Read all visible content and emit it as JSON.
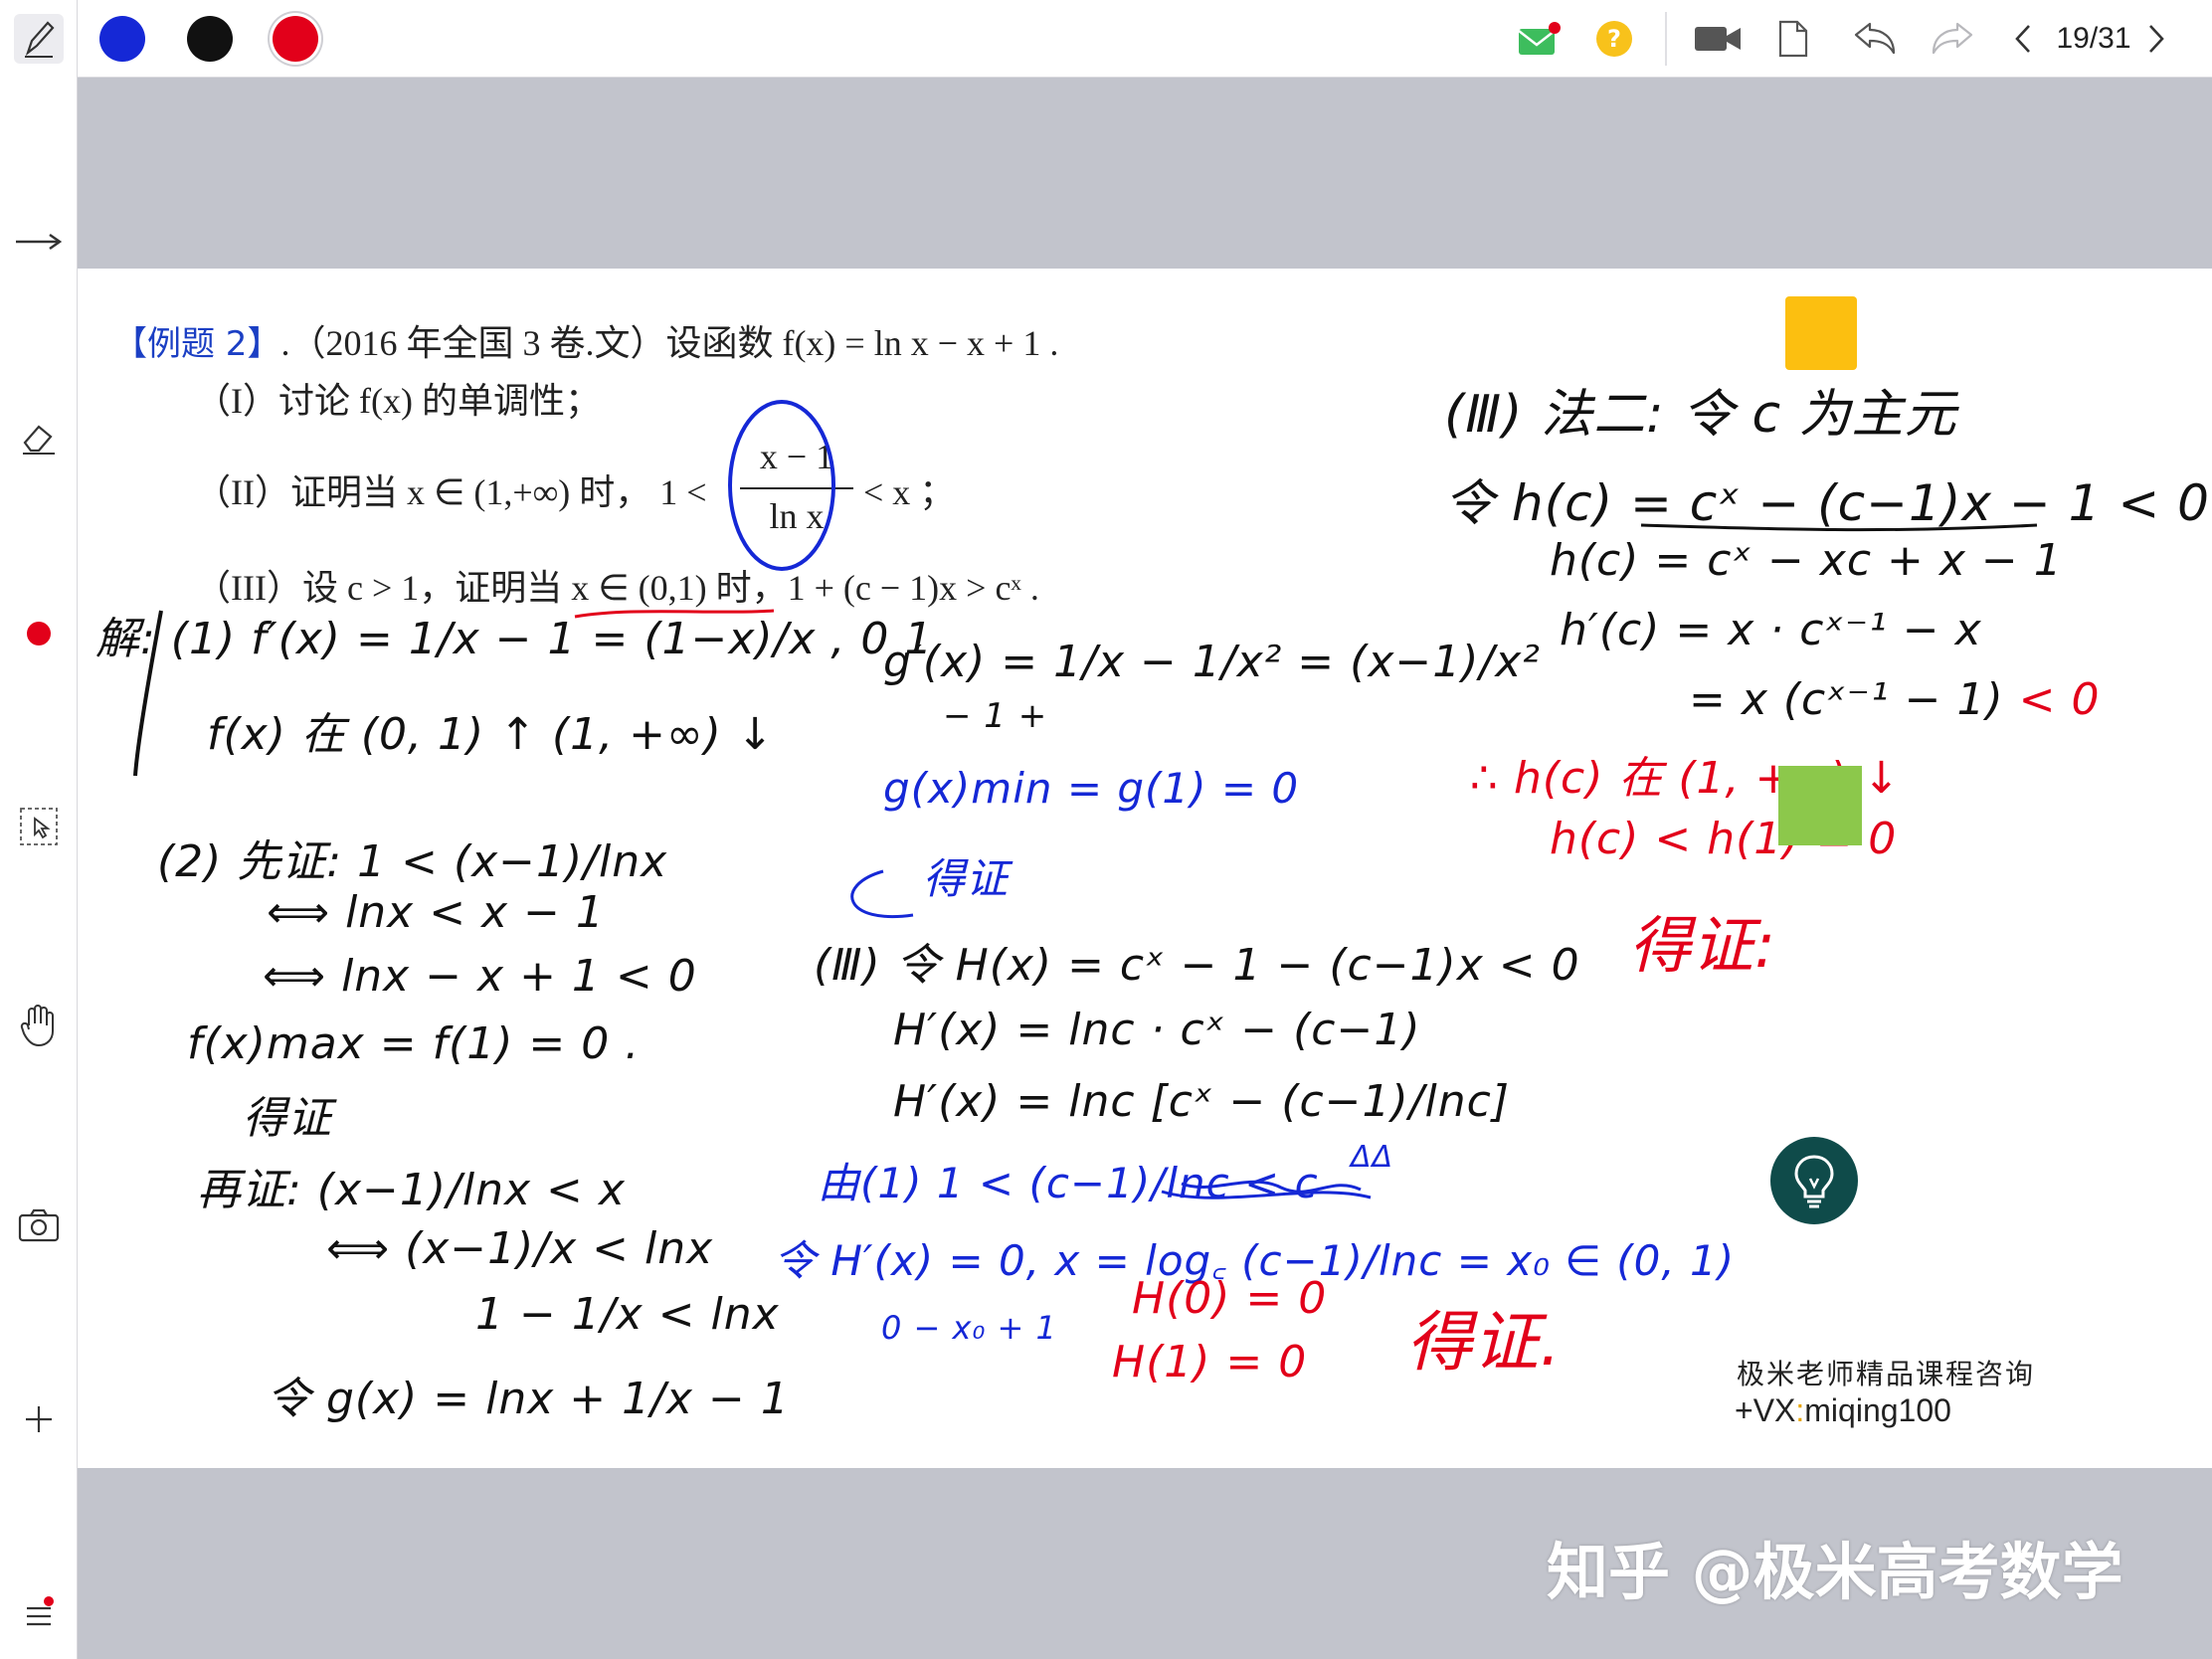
{
  "toolbar": {
    "page_counter": "19/31",
    "pen_colors": [
      "#1528d6",
      "#111111",
      "#e2001a"
    ],
    "selected_pen_color": "#e2001a",
    "icons": [
      "pen-icon",
      "mail-icon",
      "help-icon",
      "video-icon",
      "document-icon",
      "undo-icon",
      "redo-icon",
      "prev-page-icon",
      "next-page-icon"
    ]
  },
  "rail": {
    "icons": [
      "pen-tool-icon",
      "arrow-tool-icon",
      "eraser-icon",
      "laser-pointer-icon",
      "select-icon",
      "hand-icon",
      "camera-icon",
      "add-icon",
      "menu-icon"
    ]
  },
  "problem": {
    "label": "【例题 2】",
    "stem": ".（2016 年全国 3 卷.文）设函数 f(x) = ln x − x + 1 .",
    "part1": "（I）讨论 f(x) 的单调性；",
    "part2_prefix": "（II）证明当 x ∈ (1,+∞) 时，",
    "part2_ineq_left": "1 <",
    "frac_num": "x − 1",
    "frac_den": "ln x",
    "part2_ineq_right": "< x ；",
    "part3": "（III）设 c > 1，证明当 x ∈ (0,1) 时，1 + (c − 1)x > cˣ ."
  },
  "handwriting": {
    "left": [
      "解: (1) f′(x) = 1/x − 1 = (1−x)/x ,  0   1",
      "f(x) 在 (0, 1) ↑  (1, +∞) ↓",
      "(2) 先证: 1 < (x−1)/lnx",
      "⟺ lnx < x − 1",
      "⟺ lnx − x + 1 < 0",
      "f(x)max = f(1) = 0 .",
      "得证",
      "再证: (x−1)/lnx < x",
      "⟺ (x−1)/x < lnx",
      "1 − 1/x < lnx",
      "令 g(x) = lnx + 1/x − 1"
    ],
    "middle_black": [
      "g′(x) = 1/x − 1/x² = (x−1)/x²",
      "−  1  +",
      "(Ⅲ) 令 H(x) = cˣ − 1 − (c−1)x < 0",
      "H′(x) = lnc · cˣ − (c−1)",
      "H′(x) = lnc [cˣ − (c−1)/lnc]"
    ],
    "middle_blue": [
      "g(x)min = g(1) = 0",
      "得证",
      "由(1) 1 < (c−1)/lnc < c",
      "ΔΔ",
      "令 H′(x) = 0,  x = log꜀ (c−1)/lnc = x₀ ∈ (0, 1)",
      "0  −  x₀  +  1"
    ],
    "middle_red": [
      "H(0) = 0",
      "H(1) = 0",
      "得证."
    ],
    "right_black": [
      "(Ⅲ) 法二: 令 c 为主元",
      "令 h(c) = cˣ − (c−1)x − 1 < 0",
      "h(c) = cˣ − xc + x − 1",
      "h′(c) = x · cˣ⁻¹ − x",
      "= x (cˣ⁻¹ − 1) "
    ],
    "right_red": [
      "< 0",
      "∴ h(c) 在 (1, +∞) ↓",
      "h(c) < h(1) = 0",
      "得证:"
    ]
  },
  "promo": {
    "line1": "极米老师精品课程咨询",
    "line2_prefix": "+VX",
    "line2_sep": ":",
    "line2_id": "miqing100"
  },
  "watermark": "知乎 @极米高考数学"
}
